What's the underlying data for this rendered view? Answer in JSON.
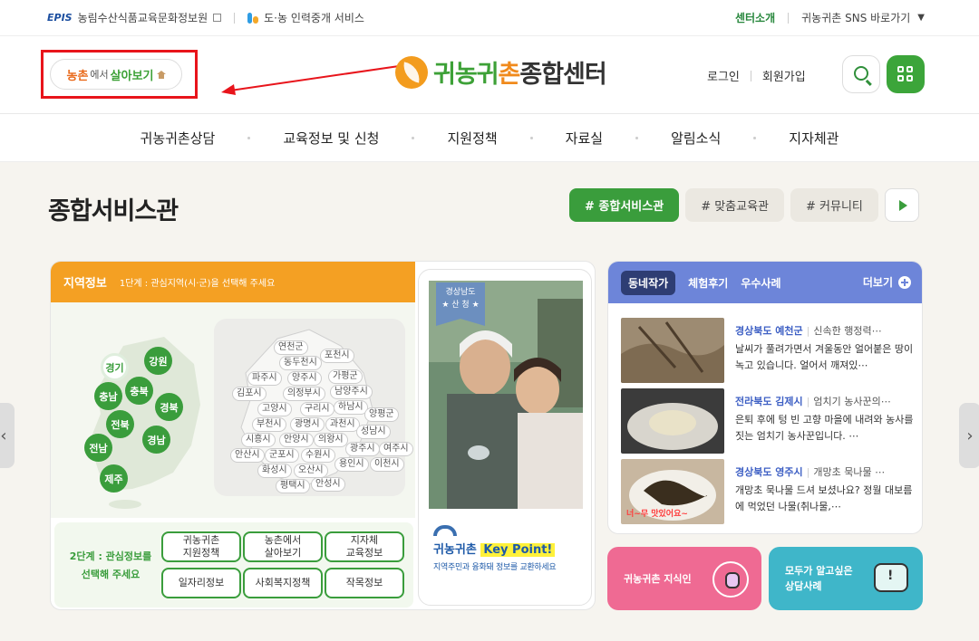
{
  "util": {
    "epis_logo": "EPIS",
    "org": "농림수산식품교육문화정보원",
    "service": "도·농 인력중개 서비스",
    "center_intro": "센터소개",
    "sns": "귀농귀촌 SNS 바로가기"
  },
  "header": {
    "live_a": "농촌",
    "live_b": "에서",
    "live_c": "살아보기",
    "logo_green": "귀농귀",
    "logo_orange": "촌",
    "logo_dark": "종합센터",
    "login": "로그인",
    "signup": "회원가입"
  },
  "gnb": [
    "귀농귀촌상담",
    "교육정보 및 신청",
    "지원정책",
    "자료실",
    "알림소식",
    "지자체관"
  ],
  "section": {
    "title": "종합서비스관",
    "tags": [
      "# 종합서비스관",
      "# 맞춤교육관",
      "# 커뮤니티"
    ]
  },
  "region": {
    "title": "지역정보",
    "step1": "1단계 : 관심지역(시·군)을 선택해 주세요",
    "provinces": [
      "경기",
      "강원",
      "충남",
      "충북",
      "경북",
      "전북",
      "경남",
      "전남",
      "제주"
    ],
    "cities": [
      "연천군",
      "포천시",
      "동두천시",
      "파주시",
      "양주시",
      "가평군",
      "김포시",
      "의정부시",
      "남양주시",
      "고양시",
      "구리시",
      "하남시",
      "부천시",
      "광명시",
      "과천시",
      "양평군",
      "시흥시",
      "안양시",
      "의왕시",
      "성남시",
      "안산시",
      "군포시",
      "수원시",
      "광주시",
      "여주시",
      "화성시",
      "오산시",
      "용인시",
      "이천시",
      "평택시",
      "안성시"
    ],
    "step2": "2단계 : 관심정보를 선택해 주세요",
    "options": [
      "귀농귀촌\n지원정책",
      "농촌에서\n살아보기",
      "지자체\n교육정보",
      "일자리정보",
      "사회복지정책",
      "작목정보"
    ],
    "photo_ribbon_top": "경상남도",
    "photo_ribbon_bottom": "★ 산 청 ★",
    "kp_a": "귀농귀촌",
    "kp_b": "Key Point!",
    "kp_desc": "지역주민과 융화돼 정보를 교환하세요"
  },
  "news": {
    "tabs": [
      "동네작가",
      "체험후기",
      "우수사례"
    ],
    "more": "더보기",
    "items": [
      {
        "region": "경상북도 예천군",
        "subject": "신속한 행정력⋯",
        "body": "날씨가 풀려가면서 겨울동안 얼어붙은 땅이 녹고 있습니다. 얼어서 깨져있⋯"
      },
      {
        "region": "전라북도 김제시",
        "subject": "엄치기 농사꾼의⋯",
        "body": "은퇴 후에 텅 빈 고향 마을에 내려와 농사를 짓는 엄치기 농사꾼입니다. ⋯"
      },
      {
        "region": "경상북도 영주시",
        "subject": "개망초 묵나물 ⋯",
        "body": "개망초 묵나물 드셔 보셨나요? 정월 대보름에 먹었던 나물(취나물,⋯"
      }
    ],
    "thumb3_caption": "너~무 맛있어요~"
  },
  "quick": {
    "pink": "귀농귀촌 지식인",
    "teal_line1": "모두가 알고싶은",
    "teal_line2": "상담사례"
  },
  "colors": {
    "accent_green": "#3a9d3c",
    "accent_orange": "#f4a023",
    "news_blue": "#6d85d9",
    "annotation_red": "#e8141b"
  }
}
